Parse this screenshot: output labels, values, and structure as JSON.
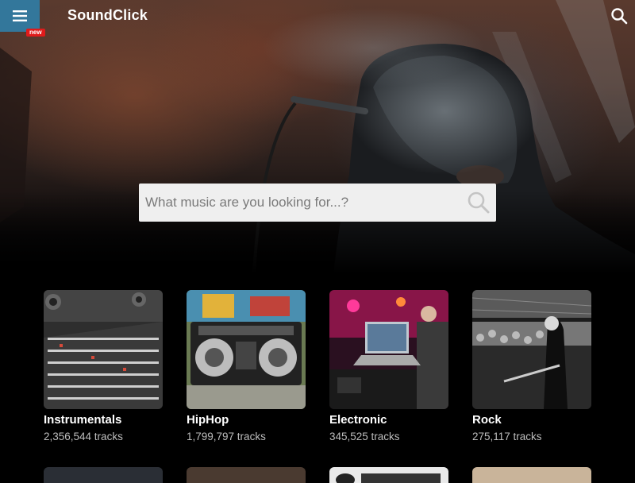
{
  "header": {
    "brand": "SoundClick",
    "menu_badge": "new",
    "menu_icon": "hamburger-icon",
    "search_icon": "search-icon"
  },
  "search": {
    "placeholder": "What music are you looking for...?",
    "value": ""
  },
  "genres": [
    {
      "name": "Instrumentals",
      "count": "2,356,544 tracks"
    },
    {
      "name": "HipHop",
      "count": "1,799,797 tracks"
    },
    {
      "name": "Electronic",
      "count": "345,525 tracks"
    },
    {
      "name": "Rock",
      "count": "275,117 tracks"
    }
  ],
  "colors": {
    "menu_bg": "#33779b",
    "badge": "#e01b1b",
    "page_bg": "#000000"
  }
}
